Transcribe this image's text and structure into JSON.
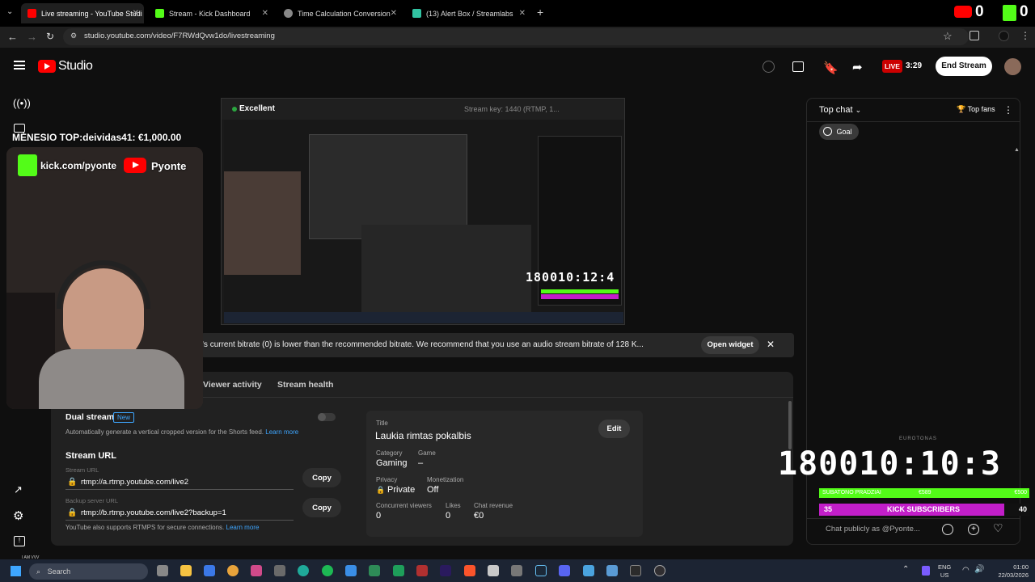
{
  "browser": {
    "tabs": [
      {
        "label": "Live streaming - YouTube Studi",
        "color": "#ff0000"
      },
      {
        "label": "Stream - Kick Dashboard",
        "color": "#53fc18"
      },
      {
        "label": "Time Calculation Conversion",
        "color": "#888888"
      },
      {
        "label": "(13) Alert Box / Streamlabs",
        "color": "#31c3a2"
      }
    ],
    "new_tab": "+",
    "url": "studio.youtube.com/video/F7RWdQvw1do/livestreaming",
    "ext_counts": [
      "0",
      "0"
    ]
  },
  "header": {
    "logo_text": "Studio",
    "live_badge": "LIVE",
    "live_time": "3:29",
    "end_stream": "End Stream"
  },
  "overlay": {
    "top_donor": "MĖNESIO TOP:deividas41: €1,000.00",
    "kick_text": "kick.com/pyonte",
    "yt_text": "Pyonte"
  },
  "preview": {
    "quality": "Excellent",
    "stream_key": "Stream key: 1440 (RTMP, 1...",
    "timer": "180010:12:4"
  },
  "banner": {
    "text": "'s current bitrate (0) is lower than the recommended bitrate. We recommend that you use an audio stream bitrate of 128 K...",
    "open_widget": "Open widget"
  },
  "tabs": {
    "viewer_activity": "Viewer activity",
    "stream_health": "Stream health"
  },
  "settings": {
    "dual_stream": "Dual stream",
    "new_badge": "New",
    "dual_desc": "Automatically generate a vertical cropped version for the Shorts feed.",
    "learn_more": "Learn more",
    "stream_url_heading": "Stream URL",
    "stream_url_label": "Stream URL",
    "stream_url": "rtmp://a.rtmp.youtube.com/live2",
    "backup_label": "Backup server URL",
    "backup_url": "rtmp://b.rtmp.youtube.com/live2?backup=1",
    "copy": "Copy",
    "rtmps_note": "YouTube also supports RTMPS for secure connections.",
    "rtmps_learn": "Learn more"
  },
  "info": {
    "title_label": "Title",
    "title": "Laukia rimtas pokalbis",
    "edit": "Edit",
    "category_label": "Category",
    "category": "Gaming",
    "game_label": "Game",
    "game": "–",
    "privacy_label": "Privacy",
    "privacy": "Private",
    "monetization_label": "Monetization",
    "monetization": "Off",
    "viewers_label": "Concurrent viewers",
    "viewers": "0",
    "likes_label": "Likes",
    "likes": "0",
    "revenue_label": "Chat revenue",
    "revenue": "€0"
  },
  "chat": {
    "title": "Top chat",
    "top_fans": "Top fans",
    "goal": "Goal",
    "overlay_small": "EUROTONAS",
    "timer": "180010:10:3",
    "bar1_left": "SUBATONO PRADZIAI",
    "bar1_mid": "€589",
    "bar1_right": "€500",
    "bar2_left": "35",
    "bar2_mid": "KICK SUBSCRIBERS",
    "bar2_right": "40",
    "placeholder": "Chat publicly as @Pyonte..."
  },
  "taskbar": {
    "search": "Search",
    "lang1": "ENG",
    "lang2": "US",
    "time": "01:00",
    "date": "22/03/2026",
    "tiny_label": "I AM VVV"
  },
  "colors": {
    "accent_red": "#ff0000",
    "kick_green": "#53fc18",
    "goal_magenta": "#c21ec9",
    "link_blue": "#3ea6ff"
  }
}
